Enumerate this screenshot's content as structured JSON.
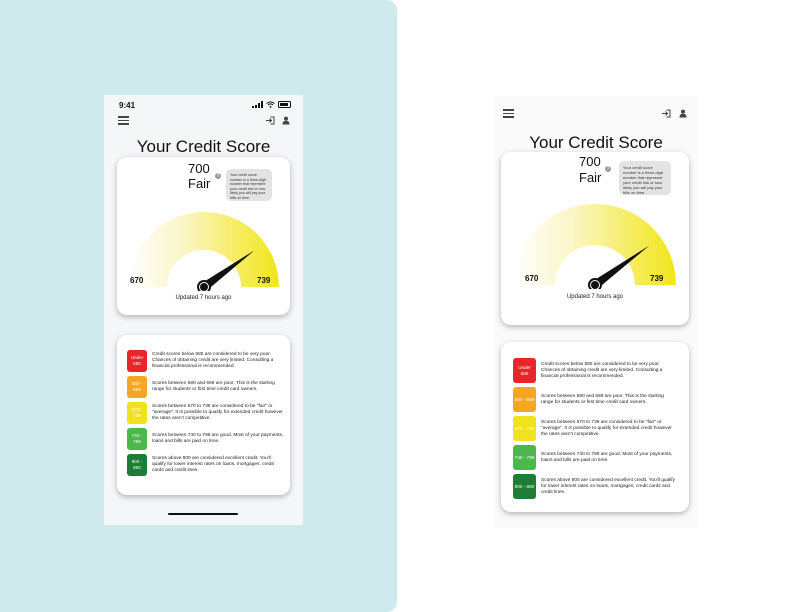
{
  "status_bar": {
    "time": "9:41"
  },
  "header": {
    "menu_icon": "hamburger-menu-icon",
    "login_icon": "sign-in-icon",
    "user_icon": "user-icon"
  },
  "title": "Your Credit Score",
  "score": {
    "value": "700",
    "rating": "Fair",
    "help_icon": "question-icon",
    "tooltip_phone": "Your credit score number is a three-digit number that represent your credit risk or how likely you will pay your bills on time.",
    "tooltip_screen": "Your credit score number is a three-digit number that represent your credit risk or how likely you will pay your bills on time.",
    "range_min": "670",
    "range_max": "739",
    "needle_fraction": 0.8,
    "updated": "Updated 7 hours ago"
  },
  "colors": {
    "very_poor": "#e8262a",
    "poor": "#f5a623",
    "fair": "#f0e21f",
    "good": "#4cb74a",
    "excellent": "#1d7d34",
    "gauge_fill": "#f2e51a",
    "needle": "#111111"
  },
  "legend": [
    {
      "badge": "Under 580",
      "desc_phone": "Credit scores below 580 are considered to be very poor. Chances of obtaining credit are very limited. Consulting a financial professional is recommended.",
      "desc_screen": "Credit scores below 580 are considered to be very poor. Chances of obtaining credit are very limited. Consulting a financial professional is recommended."
    },
    {
      "badge": "580 - 669",
      "desc_phone": "Scores between 580 and 669 are poor. This is the starting range for students  or first time credit card owners.",
      "desc_screen": "Scores between 580 and 669 are poor. This is the starting range for students  or first time credit card owners."
    },
    {
      "badge": "670 - 739",
      "desc_phone": "Scores between 670 to 739 are considered to be \"fair\" or \"average\". It is possible to qualify for extended credit however the rates aren't competitive.",
      "desc_screen": "Scores between 670 to 739 are considered to be \"fair\" or \"average\". It is possible to qualify for extended credit however the rates aren't competitive."
    },
    {
      "badge": "740 - 799",
      "desc_phone": "Scores between 740 to 799 are good. Most of your payments, loans and bills are paid on time.",
      "desc_screen": "Scores between 740 to 799 are good. Most of your payments, loans and bills are paid on time."
    },
    {
      "badge": "800 - 850",
      "desc_phone": "Scores above 800 are considered excellent credit. You'll qualify for lower interest rates on loans, mortgages, credit cards and credit lines.",
      "desc_screen": "Scores above 800 are considered excellent credit. You'll qualify for lower interest rates on loans, mortgages, credit cards and credit lines."
    }
  ]
}
